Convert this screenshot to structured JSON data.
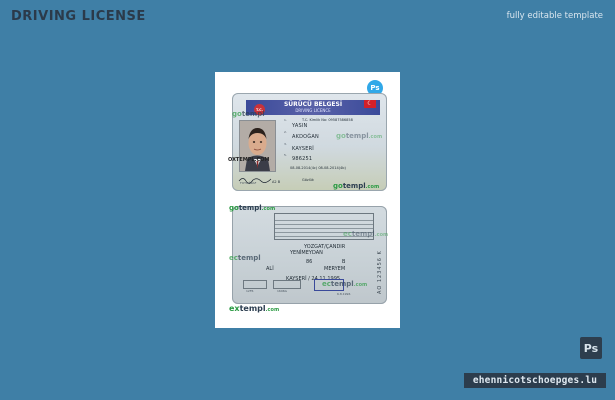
{
  "header": {
    "title": "DRIVING LICENSE",
    "subtitle": "fully editable template"
  },
  "sheet": {
    "ps_badge": "Ps"
  },
  "front": {
    "emblem": "T.C.",
    "title": "SÜRÜCÜ BELGESİ",
    "subtitle": "DRIVING LICENCE",
    "id_line": "T.C. Kimlik No: 09587586858",
    "surname": "YASIN",
    "name": "AKDOĞAN",
    "birth_place": "KAYSERİ",
    "doc_no": "986251",
    "dates": "08-08-2014(4c)  08-08-2014(4b)",
    "photo_caption": "FOTOĞRAF",
    "blood": "A2 B",
    "vision": "Gözlük"
  },
  "back": {
    "city": "YOZGAT/ÇANDIR",
    "street": "YENİMEYDAN",
    "number": "86",
    "letter": "B",
    "father": "ALİ",
    "mother": "MERYEM",
    "issue": "KAYSERİ / 24.11.1995",
    "code_left": "12F6",
    "code_mid": "1696G",
    "date_small": "6.8.1996",
    "vertical_text": "AO 123456 K"
  },
  "watermarks": {
    "brand_ex": "ex",
    "brand_go": "go",
    "brand_ec": "ec",
    "brand_main": "templ",
    "brand_tld": ".com",
    "oxtempl": "OXTEMPL.COM"
  },
  "footer": {
    "ps_logo": "Ps",
    "site": "ehennicotschoepges.lu"
  },
  "colors": {
    "background": "#3f7fa6",
    "card_header": "#3a4a9a",
    "watermark_green": "#2a9a42"
  }
}
